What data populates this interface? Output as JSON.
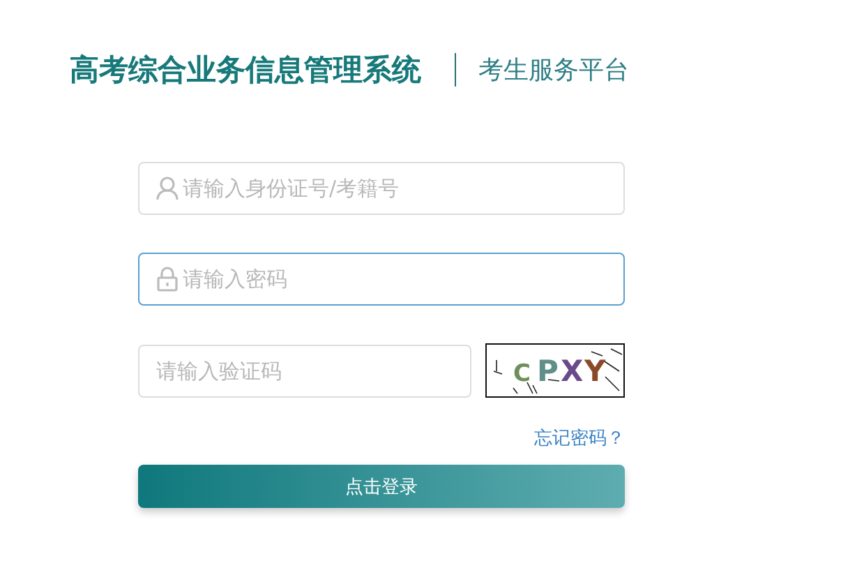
{
  "header": {
    "title": "高考综合业务信息管理系统",
    "subtitle": "考生服务平台"
  },
  "fields": [
    {
      "kind": "id",
      "placeholder": "请输入身份证号/考籍号",
      "focused": false
    },
    {
      "kind": "password",
      "placeholder": "请输入密码",
      "focused": true
    },
    {
      "kind": "captcha",
      "placeholder": "请输入验证码",
      "focused": false
    }
  ],
  "captcha": {
    "chars": [
      {
        "char": "C",
        "color": "#6f8f5a"
      },
      {
        "char": "P",
        "color": "#5f8f88"
      },
      {
        "char": "X",
        "color": "#6a4a8a"
      },
      {
        "char": "Y",
        "color": "#8a4a2a"
      }
    ]
  },
  "forgot_link": "忘记密码？",
  "login_button": "点击登录"
}
